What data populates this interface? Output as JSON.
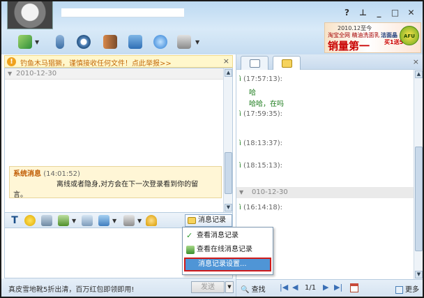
{
  "window": {
    "controls": {
      "help": "?",
      "pin": "⊥",
      "minimize": "_",
      "maximize": "□",
      "close": "✕"
    }
  },
  "ad_banner": {
    "line1": "2010.12至今",
    "line2": "淘宝全网 精油洗面乳",
    "headline": "销量第一",
    "right1": "洁面晶",
    "right2": "买1送5",
    "logo": "AFU"
  },
  "notice": {
    "icon": "!",
    "text": "钓鱼木马猖獗，谨慎接收任何文件！点此举报>>",
    "close": "×"
  },
  "chat": {
    "date": "2010-12-30",
    "system_message": {
      "title": "系统消息",
      "time": "(14:01:52)",
      "body_part1": "离线或者隐身,对方会在下一次登录看到你的留",
      "body_part2": "言。"
    }
  },
  "format_toolbar": {
    "msg_record_label": "消息记录"
  },
  "menu": {
    "items": [
      {
        "label": "查看消息记录"
      },
      {
        "label": "查看在线消息记录"
      },
      {
        "label": "消息记录设置..."
      }
    ]
  },
  "bottom": {
    "ad_text": "真皮雪地靴5折出清，百万红包即领即用!",
    "send_label": "发送"
  },
  "history": {
    "entries": [
      {
        "time": "(17:57:13):",
        "messages": [
          "哈",
          "哈哈，在吗"
        ]
      },
      {
        "time": "(17:59:35):",
        "messages": []
      },
      {
        "time": "(18:13:37):",
        "messages": []
      },
      {
        "time": "(18:15:13):",
        "messages": []
      }
    ],
    "date2": "010-12-30",
    "entry_after_date": {
      "time": "(16:14:18):"
    }
  },
  "right_bottom": {
    "search_label": "查找",
    "first": "|◀",
    "prev": "◀",
    "page": "1/1",
    "next": "▶",
    "last": "▶|",
    "more_label": "更多"
  }
}
